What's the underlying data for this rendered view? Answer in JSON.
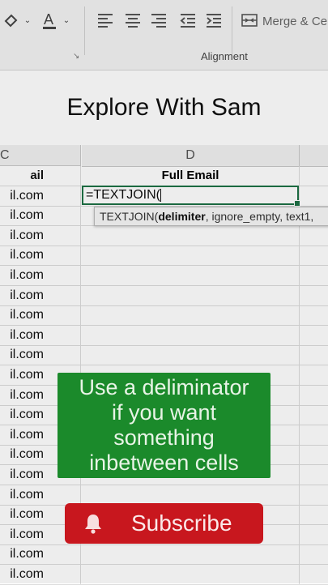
{
  "ribbon": {
    "group_label": "Alignment",
    "merge_label": "Merge & Ce"
  },
  "overlay": {
    "channel_title": "Explore With Sam",
    "callout_lines": [
      "Use a deliminator",
      "if you want",
      "something",
      "inbetween cells"
    ],
    "subscribe_label": "Subscribe"
  },
  "sheet": {
    "column_c": "C",
    "column_d": "D",
    "header_c": "ail",
    "header_d": "Full Email",
    "active_cell_value": "=TEXTJOIN(",
    "tooltip": {
      "func": "TEXTJOIN(",
      "current_arg": "delimiter",
      "rest": ", ignore_empty, text1,"
    },
    "column_c_values": [
      "il.com",
      "il.com",
      "il.com",
      "il.com",
      "il.com",
      "il.com",
      "il.com",
      "il.com",
      "il.com",
      "il.com",
      "il.com",
      "il.com",
      "il.com",
      "il.com",
      "il.com",
      "il.com",
      "il.com",
      "il.com",
      "il.com",
      "il.com"
    ]
  },
  "colors": {
    "accent_green": "#1e7145",
    "callout_green": "#1b8a2b",
    "subscribe_red": "#c8171e"
  }
}
